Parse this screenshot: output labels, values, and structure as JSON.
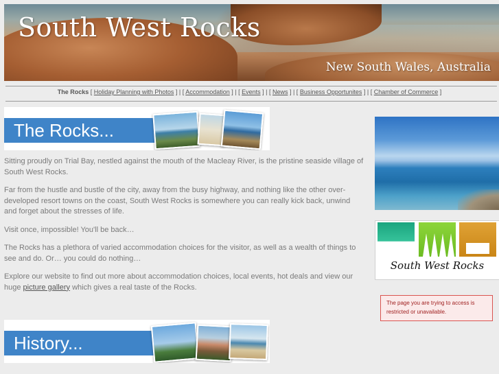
{
  "header": {
    "title": "South West Rocks",
    "subtitle": "New South Wales, Australia"
  },
  "nav": {
    "current": "The Rocks",
    "links": [
      "Holiday Planning with Photos",
      "Accommodation",
      "Events",
      "News",
      "Business Opportunites",
      "Chamber of Commerce"
    ]
  },
  "sections": {
    "rocks_heading": "The Rocks...",
    "history_heading": "History..."
  },
  "content": {
    "p1": "Sitting proudly on Trial Bay, nestled against the mouth of the Macleay River, is the pristine seaside village of South West Rocks.",
    "p2": "Far from the hustle and bustle of the city, away from the busy highway, and nothing like the other over-developed resort towns on the coast, South West Rocks is somewhere you can really kick back, unwind and forget about the stresses of life.",
    "p3": "Visit once, impossible! You'll be back…",
    "p4": "The Rocks has a plethora of varied accommodation choices for the visitor, as well as a wealth of things to see and do. Or… you could do nothing…",
    "p5_before": "Explore our website to find out more about accommodation choices, local events, hot deals and view our huge ",
    "p5_link": "picture gallery",
    "p5_after": " which gives a real taste of the Rocks."
  },
  "sidebar": {
    "logo_text": "South West Rocks",
    "notice": "The page you are trying to access is restricted or unavailable."
  },
  "colors": {
    "page_bg": "#ececec",
    "heading_blue": "#3f84c8",
    "body_text": "#7a7a7a",
    "notice_border": "#d9534f"
  }
}
